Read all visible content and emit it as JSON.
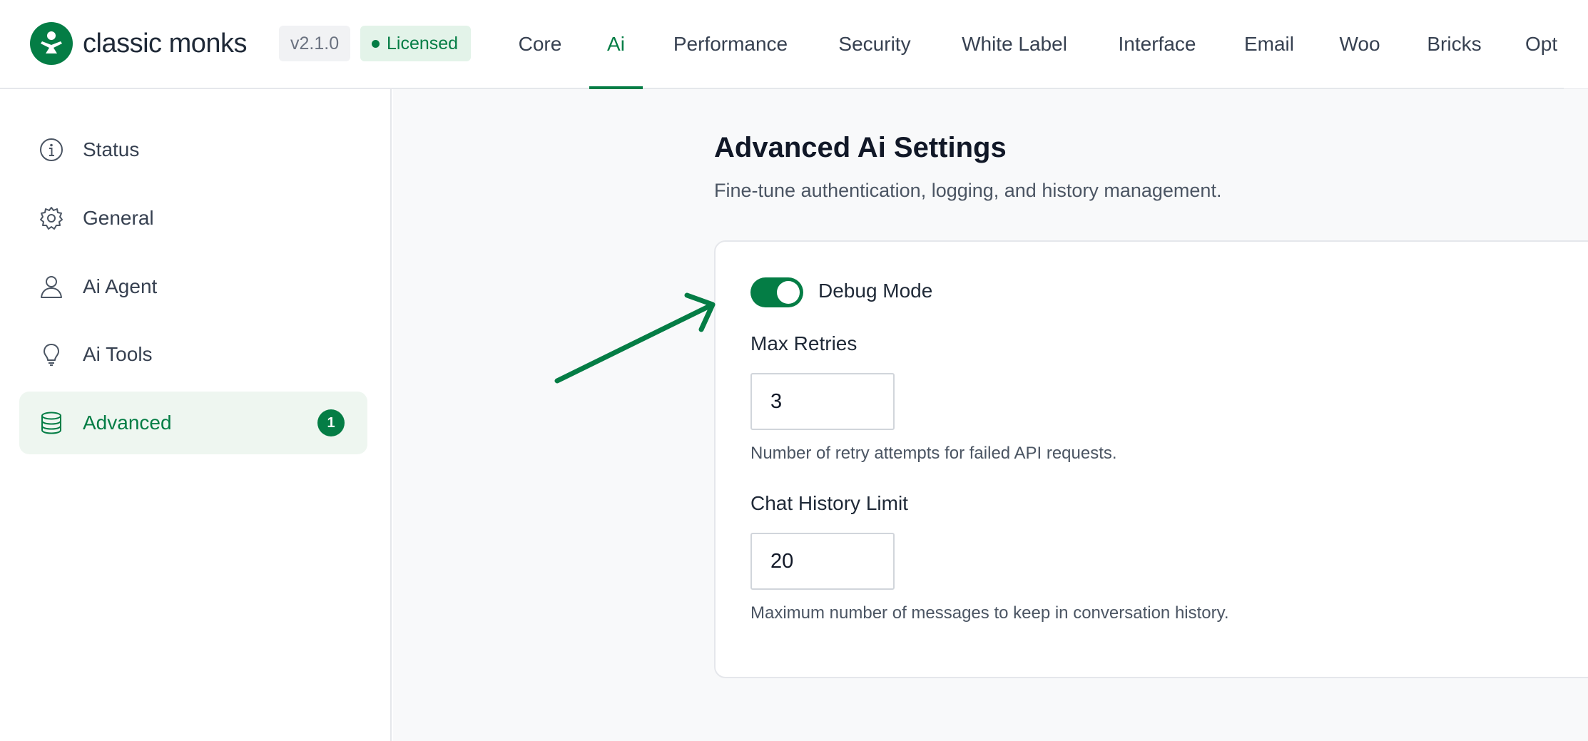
{
  "header": {
    "brand": "classic monks",
    "version": "v2.1.0",
    "license_status": "Licensed",
    "tabs": [
      {
        "label": "Core",
        "active": false
      },
      {
        "label": "Ai",
        "active": true
      },
      {
        "label": "Performance",
        "active": false
      },
      {
        "label": "Security",
        "active": false
      },
      {
        "label": "White Label",
        "active": false
      },
      {
        "label": "Interface",
        "active": false
      },
      {
        "label": "Email",
        "active": false
      },
      {
        "label": "Woo",
        "active": false
      },
      {
        "label": "Bricks",
        "active": false
      },
      {
        "label": "Opt",
        "active": false
      }
    ]
  },
  "sidebar": {
    "items": [
      {
        "label": "Status",
        "icon": "info-icon",
        "active": false
      },
      {
        "label": "General",
        "icon": "gear-icon",
        "active": false
      },
      {
        "label": "Ai Agent",
        "icon": "user-icon",
        "active": false
      },
      {
        "label": "Ai Tools",
        "icon": "lightbulb-icon",
        "active": false
      },
      {
        "label": "Advanced",
        "icon": "database-icon",
        "active": true,
        "badge": "1"
      }
    ]
  },
  "main": {
    "title": "Advanced Ai Settings",
    "subtitle": "Fine-tune authentication, logging, and history management.",
    "debug_mode": {
      "label": "Debug Mode",
      "enabled": true
    },
    "fields": [
      {
        "label": "Max Retries",
        "value": "3",
        "help": "Number of retry attempts for failed API requests."
      },
      {
        "label": "Chat History Limit",
        "value": "20",
        "help": "Maximum number of messages to keep in conversation history."
      }
    ]
  },
  "colors": {
    "accent": "#047d45",
    "accent_light": "#eef6f0",
    "license_bg": "#e3f3e9",
    "main_bg": "#f8f9fa",
    "border": "#e5e7eb"
  }
}
